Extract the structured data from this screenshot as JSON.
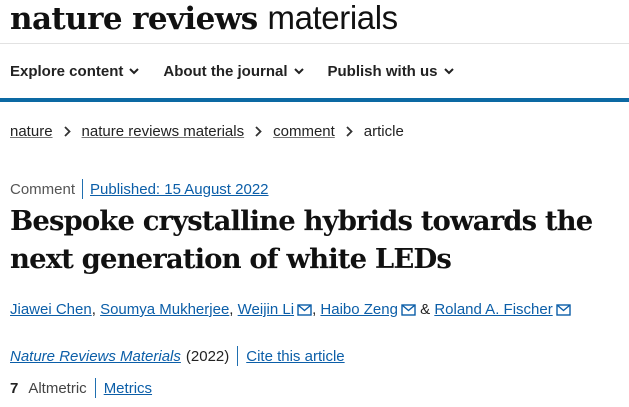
{
  "logo": {
    "bold": "nature reviews",
    "light": "materials"
  },
  "nav": {
    "items": [
      {
        "label": "Explore content",
        "icon": "chevron-down-icon"
      },
      {
        "label": "About the journal",
        "icon": "chevron-down-icon"
      },
      {
        "label": "Publish with us",
        "icon": "chevron-down-icon"
      }
    ]
  },
  "breadcrumb": {
    "items": [
      "nature",
      "nature reviews materials",
      "comment"
    ],
    "current": "article"
  },
  "article": {
    "type": "Comment",
    "published": "Published: 15 August 2022",
    "title": "Bespoke crystalline hybrids towards the next generation of white LEDs",
    "authors": [
      {
        "name": "Jiawei Chen",
        "after": ", "
      },
      {
        "name": "Soumya Mukherjee",
        "after": ", "
      },
      {
        "name": "Weijin Li",
        "after": ", "
      },
      {
        "name": "Haibo Zeng",
        "after": " & "
      },
      {
        "name": "Roland A. Fischer",
        "after": ""
      }
    ],
    "journal": "Nature Reviews Materials",
    "year": "(2022)",
    "cite": "Cite this article",
    "altmetric_count": "7",
    "altmetric_label": "Altmetric",
    "metrics_label": "Metrics"
  },
  "colors": {
    "accent": "#0c69a3",
    "link": "#0b5ea8",
    "text": "#222222"
  }
}
